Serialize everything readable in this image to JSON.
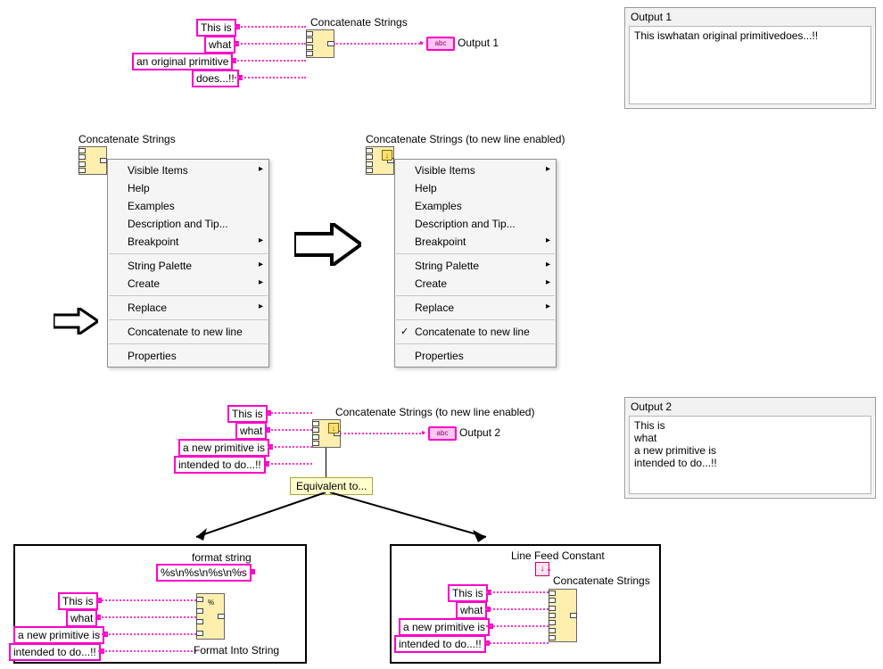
{
  "section1": {
    "inputs": [
      "This is",
      "what",
      "an original primitive",
      "does...!!"
    ],
    "node_label": "Concatenate Strings",
    "output_label": "Output 1"
  },
  "output_panes": {
    "o1": {
      "title": "Output 1",
      "body": "This iswhatan original primitivedoes...!!"
    },
    "o2": {
      "title": "Output 2",
      "body": "This is\nwhat\na new primitive is\nintended to do...!!"
    }
  },
  "menus": {
    "left_title": "Concatenate Strings",
    "right_title": "Concatenate Strings (to new line enabled)",
    "items": [
      {
        "label": "Visible Items",
        "sub": true
      },
      {
        "label": "Help"
      },
      {
        "label": "Examples"
      },
      {
        "label": "Description and Tip..."
      },
      {
        "label": "Breakpoint",
        "sub": true
      },
      {
        "sep": true
      },
      {
        "label": "String Palette",
        "sub": true
      },
      {
        "label": "Create",
        "sub": true
      },
      {
        "sep": true
      },
      {
        "label": "Replace",
        "sub": true
      },
      {
        "sep": true
      },
      {
        "label": "Concatenate to new line",
        "toggle": true
      },
      {
        "sep": true
      },
      {
        "label": "Properties"
      }
    ]
  },
  "section3": {
    "inputs": [
      "This is",
      "what",
      "a new primitive is",
      "intended to do...!!"
    ],
    "node_label": "Concatenate Strings (to new line enabled)",
    "output_label": "Output 2",
    "card": "Equivalent to..."
  },
  "eq_left": {
    "format_label": "format string",
    "format_value": "%s\\n%s\\n%s\\n%s",
    "node_label": "Format Into String",
    "inputs": [
      "This is",
      "what",
      "a new primitive is",
      "intended to do...!!"
    ]
  },
  "eq_right": {
    "lf_label": "Line Feed Constant",
    "node_label": "Concatenate Strings",
    "inputs": [
      "This is",
      "what",
      "a new primitive is",
      "intended to do...!!"
    ]
  }
}
